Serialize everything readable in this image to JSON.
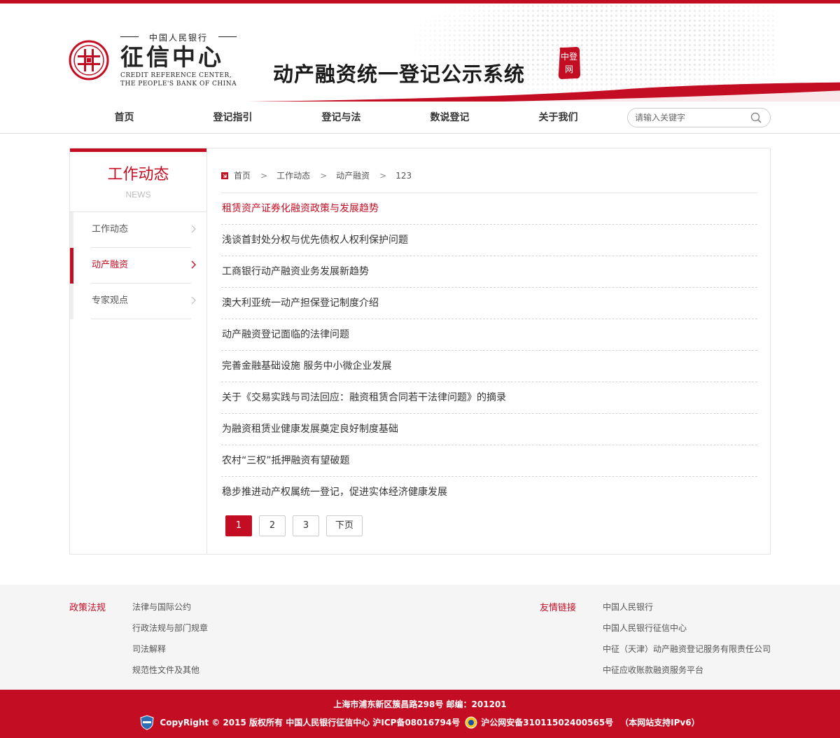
{
  "header": {
    "org_cn_small": "中国人民银行",
    "org_cn_main": "征信中心",
    "org_en_line1": "CREDIT REFERENCE CENTER,",
    "org_en_line2": "THE PEOPLE'S BANK OF CHINA",
    "system_title": "动产融资统一登记公示系统",
    "seal_text": "中登网"
  },
  "nav": {
    "items": [
      "首页",
      "登记指引",
      "登记与法",
      "数说登记",
      "关于我们"
    ],
    "search_placeholder": "请输入关键字"
  },
  "sidebar": {
    "title": "工作动态",
    "subtitle": "NEWS",
    "items": [
      {
        "label": "工作动态",
        "active": false
      },
      {
        "label": "动产融资",
        "active": true
      },
      {
        "label": "专家观点",
        "active": false
      }
    ]
  },
  "breadcrumb": [
    "首页",
    "工作动态",
    "动产融资",
    "123"
  ],
  "articles": [
    "租赁资产证券化融资政策与发展趋势",
    "浅谈首封处分权与优先债权人权利保护问题",
    "工商银行动产融资业务发展新趋势",
    "澳大利亚统一动产担保登记制度介绍",
    "动产融资登记面临的法律问题",
    "完善金融基础设施 服务中小微企业发展",
    "关于《交易实践与司法回应：融资租赁合同若干法律问题》的摘录",
    "为融资租赁业健康发展奠定良好制度基础",
    "农村“三权”抵押融资有望破题",
    "稳步推进动产权属统一登记，促进实体经济健康发展"
  ],
  "pagination": {
    "pages": [
      "1",
      "2",
      "3"
    ],
    "current": "1",
    "next": "下页"
  },
  "footer": {
    "policy_title": "政策法规",
    "policy_links": [
      "法律与国际公约",
      "行政法规与部门规章",
      "司法解释",
      "规范性文件及其他"
    ],
    "friend_title": "友情链接",
    "friend_links": [
      "中国人民银行",
      "中国人民银行征信中心",
      "中征（天津）动产融资登记服务有限责任公司",
      "中征应收账款融资服务平台"
    ],
    "address": "上海市浦东新区簇昌路298号 邮编：201201",
    "copyright": "CopyRight © 2015 版权所有 中国人民银行征信中心 沪ICP备08016794号",
    "police": "沪公网安备31011502400565号",
    "ipv6": "（本网站支持IPv6）"
  },
  "colors": {
    "brand_red": "#c30d23"
  }
}
